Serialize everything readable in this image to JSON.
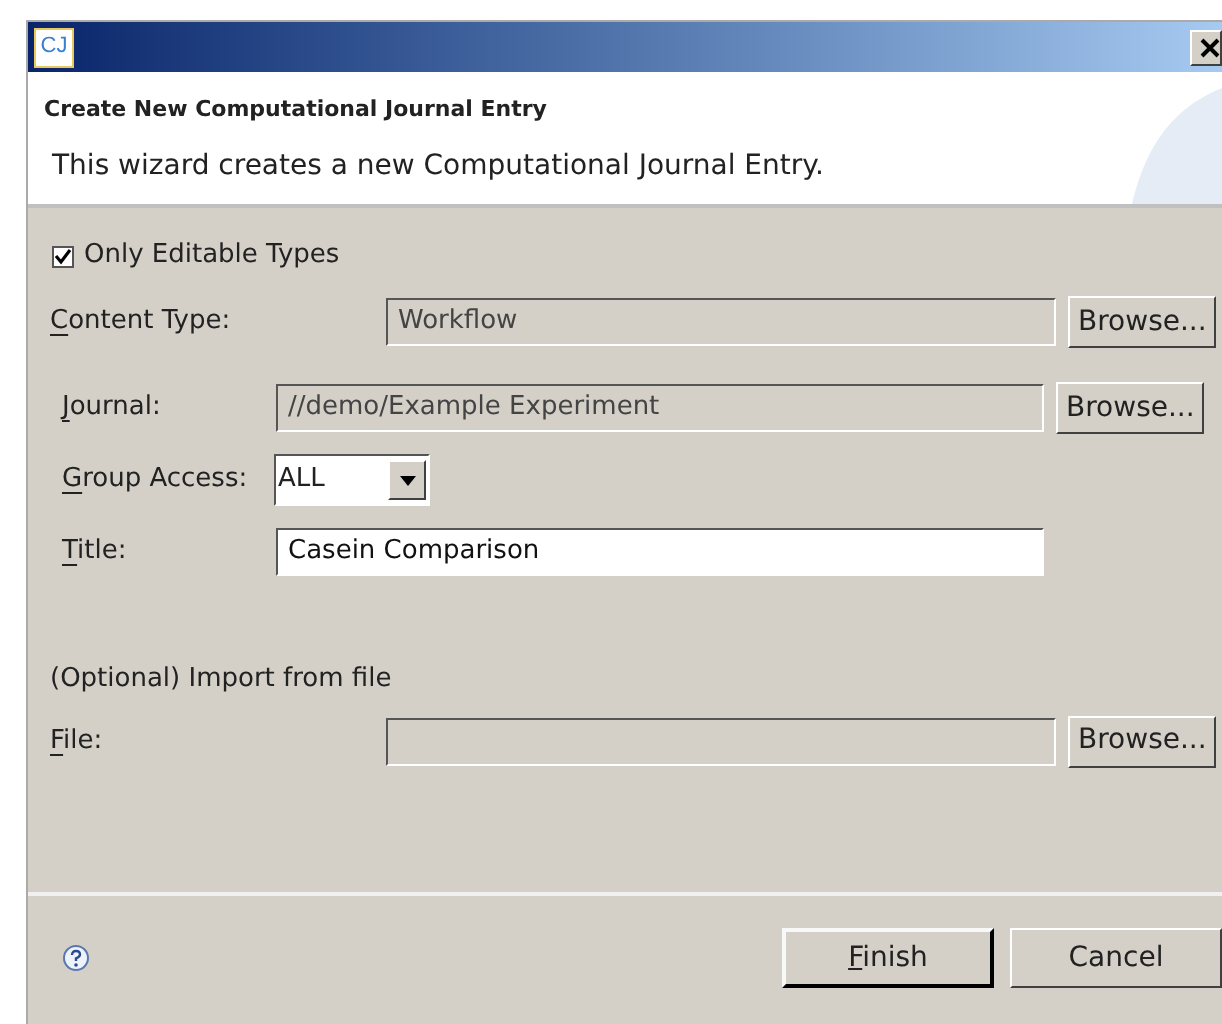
{
  "window": {
    "icon_text": "CJ"
  },
  "header": {
    "title": "Create New Computational Journal Entry",
    "description": "This wizard creates a new Computational Journal Entry."
  },
  "only_editable": {
    "label": "Only Editable Types",
    "checked": true
  },
  "content_type": {
    "label": "Content Type:",
    "mnemonic": true,
    "value": "Workflow",
    "disabled": true,
    "button": "Browse..."
  },
  "journal": {
    "label": "Journal:",
    "mnemonic": true,
    "value": "//demo/Example Experiment",
    "disabled": true,
    "button": "Browse..."
  },
  "group_access": {
    "label": "Group Access:",
    "mnemonic": true,
    "value": "ALL"
  },
  "title_field": {
    "label": "Title:",
    "mnemonic": true,
    "value": "Casein Comparison",
    "disabled": false
  },
  "import_heading": "(Optional) Import from file",
  "file": {
    "label": "File:",
    "mnemonic": true,
    "disabled": true,
    "button": "Browse..."
  },
  "buttons": [
    {
      "label": "Finish",
      "mnemonic": true,
      "default": true
    },
    {
      "label": "Cancel",
      "mnemonic": false,
      "default": false
    }
  ]
}
